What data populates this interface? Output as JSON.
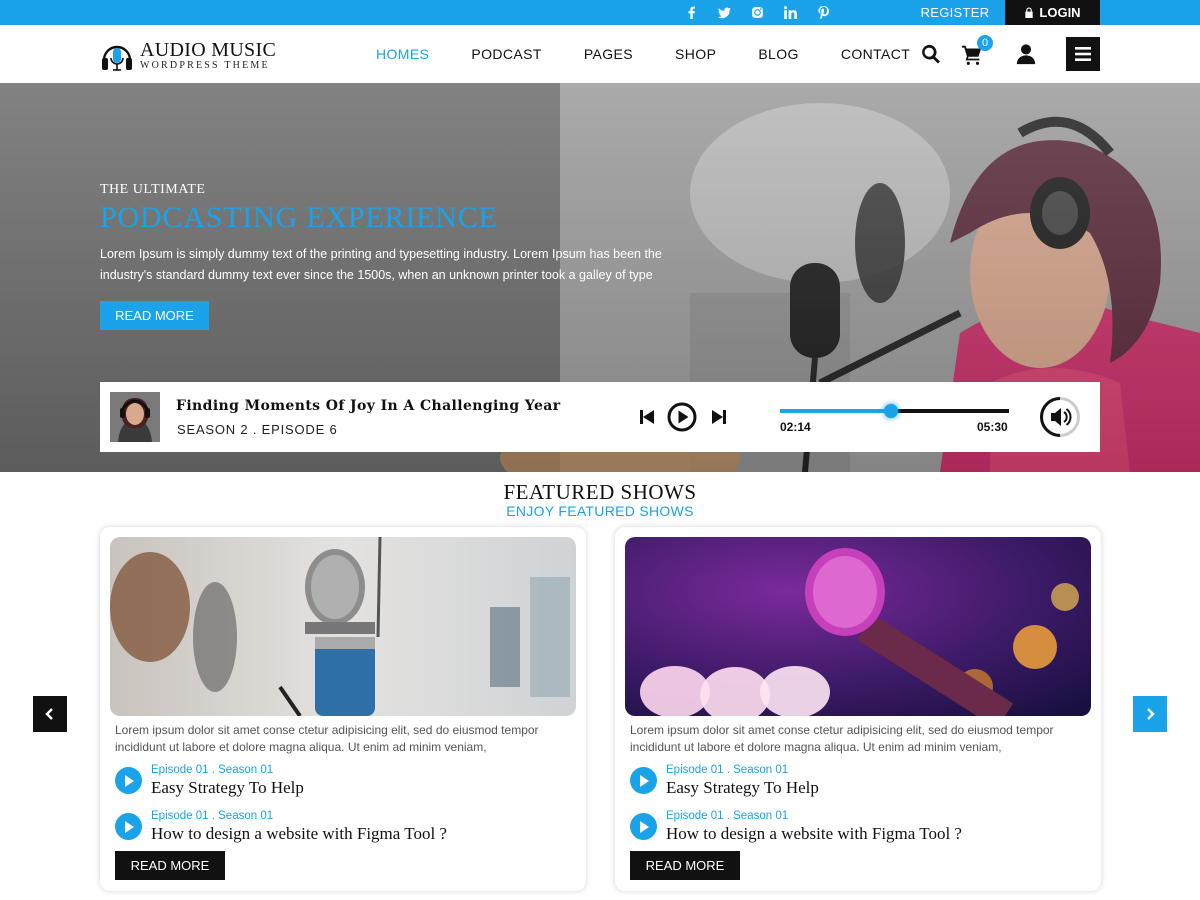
{
  "topbar": {
    "social_icons": [
      "facebook-icon",
      "twitter-icon",
      "instagram-icon",
      "linkedin-icon",
      "pinterest-icon"
    ],
    "register_label": "REGISTER",
    "login_label": "LOGIN"
  },
  "logo": {
    "title": "AUDIO MUSIC",
    "subtitle": "WORDPRESS THEME"
  },
  "nav": {
    "items": [
      "HOMES",
      "PODCAST",
      "PAGES",
      "SHOP",
      "BLOG",
      "CONTACT"
    ],
    "active": "HOMES"
  },
  "header_icons": {
    "cart_count": "0"
  },
  "hero": {
    "small_title": "THE ULTIMATE",
    "title": "PODCASTING EXPERIENCE",
    "description": "Lorem Ipsum is simply dummy text of the printing and typesetting industry. Lorem Ipsum has been the industry's standard dummy text ever since the 1500s, when an unknown printer took a galley of type",
    "button_label": "READ MORE"
  },
  "player": {
    "track_title": "Finding Moments Of Joy In A Challenging Year",
    "track_subtitle": "SEASON 2 . EPISODE 6",
    "current_time": "02:14",
    "total_time": "05:30",
    "progress_fraction": 0.485
  },
  "featured": {
    "title": "FEATURED SHOWS",
    "subtitle": "ENJOY FEATURED SHOWS",
    "cards": [
      {
        "text": "Lorem ipsum dolor sit amet conse ctetur adipisicing elit, sed do eiusmod tempor incididunt ut labore et dolore magna aliqua. Ut enim ad minim veniam,",
        "episodes": [
          {
            "label": "Episode 01 . Season 01",
            "title": "Easy Strategy To Help"
          },
          {
            "label": "Episode 01 . Season 01",
            "title": "How to design a website with Figma Tool ?"
          }
        ],
        "button_label": "READ MORE"
      },
      {
        "text": "Lorem ipsum dolor sit amet conse ctetur adipisicing elit, sed do eiusmod tempor incididunt ut labore et dolore magna aliqua. Ut enim ad minim veniam,",
        "episodes": [
          {
            "label": "Episode 01 . Season 01",
            "title": "Easy Strategy To Help"
          },
          {
            "label": "Episode 01 . Season 01",
            "title": "How to design a website with Figma Tool ?"
          }
        ],
        "button_label": "READ MORE"
      }
    ]
  },
  "colors": {
    "accent": "#1aa3e8",
    "dark": "#111111"
  }
}
